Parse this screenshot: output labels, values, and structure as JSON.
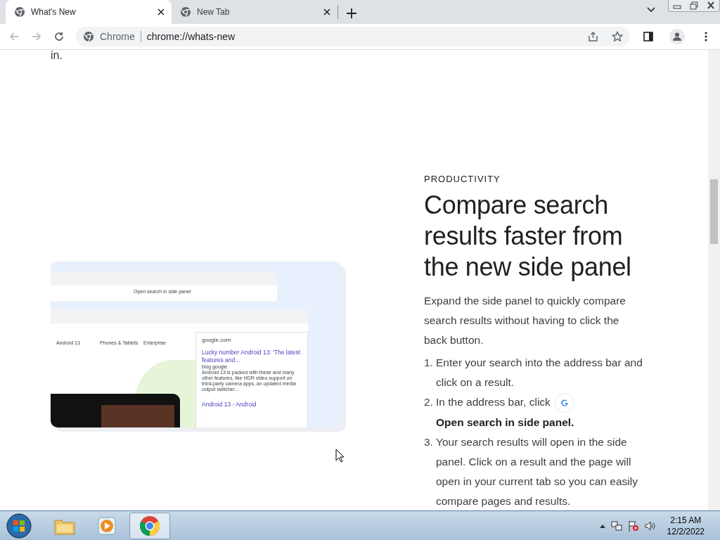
{
  "tabs": [
    {
      "title": "What's New",
      "selected": true
    },
    {
      "title": "New Tab",
      "selected": false
    }
  ],
  "address_bar": {
    "site_label": "Chrome",
    "url": "chrome://whats-new"
  },
  "page": {
    "previous_text_tail": "in.",
    "category": "PRODUCTIVITY",
    "heading": "Compare search results faster from the new side panel",
    "intro": "Expand the side panel to quickly compare search results without having to click the back button.",
    "steps": [
      {
        "number": "1.",
        "text": "Enter your search into the address bar and click on a result."
      },
      {
        "number": "2.",
        "text": "In the address bar, click",
        "action": "Open search in side panel."
      },
      {
        "number": "3.",
        "text": "Your search results will open in the side panel. Click on a result and the page will open in your current tab so you can easily compare pages and results."
      }
    ],
    "illustration": {
      "chip_label": "Open search in side panel",
      "nav_links": [
        "Android 13",
        "Phones & Tablets",
        "Enterprise"
      ],
      "panel_site": "google.com",
      "result_title": "Lucky number Android 13: 'The latest features and...",
      "result_source": "blog.google",
      "result_snippet": "Android 13 is packed with these and many other features, like HDR video support on third-party camera apps, an updated media output switcher...",
      "next_result_title": "Android 13 - Android"
    }
  },
  "taskbar": {
    "time": "2:15 AM",
    "date": "12/2/2022"
  }
}
